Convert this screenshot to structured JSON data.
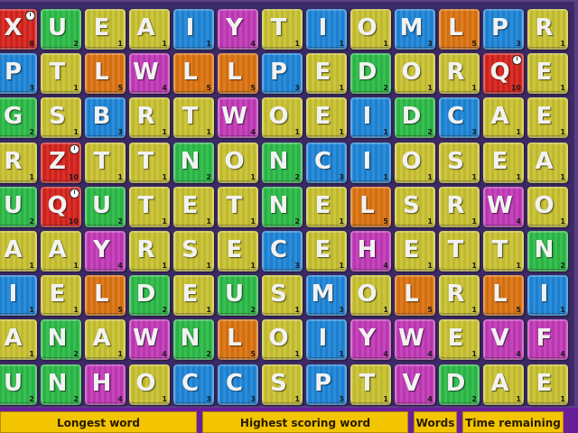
{
  "colors": {
    "Y": "#c9c233",
    "B": "#1f86d8",
    "G": "#2dbb48",
    "P": "#c23ab8",
    "O": "#dc7412",
    "R": "#d7241e"
  },
  "grid": [
    [
      [
        "X",
        "8",
        "R",
        true
      ],
      [
        "U",
        "2",
        "G"
      ],
      [
        "E",
        "1",
        "Y"
      ],
      [
        "A",
        "1",
        "Y"
      ],
      [
        "I",
        "1",
        "B"
      ],
      [
        "Y",
        "4",
        "P"
      ],
      [
        "T",
        "1",
        "Y"
      ],
      [
        "I",
        "1",
        "B"
      ],
      [
        "O",
        "1",
        "Y"
      ],
      [
        "M",
        "3",
        "B"
      ],
      [
        "L",
        "5",
        "O"
      ],
      [
        "P",
        "3",
        "B"
      ],
      [
        "R",
        "1",
        "Y"
      ]
    ],
    [
      [
        "P",
        "3",
        "B"
      ],
      [
        "T",
        "1",
        "Y"
      ],
      [
        "L",
        "5",
        "O"
      ],
      [
        "W",
        "4",
        "P"
      ],
      [
        "L",
        "5",
        "O"
      ],
      [
        "L",
        "5",
        "O"
      ],
      [
        "P",
        "3",
        "B"
      ],
      [
        "E",
        "1",
        "Y"
      ],
      [
        "D",
        "2",
        "G"
      ],
      [
        "O",
        "1",
        "Y"
      ],
      [
        "R",
        "1",
        "Y"
      ],
      [
        "Q",
        "10",
        "R",
        true
      ],
      [
        "E",
        "1",
        "Y"
      ]
    ],
    [
      [
        "G",
        "2",
        "G"
      ],
      [
        "S",
        "1",
        "Y"
      ],
      [
        "B",
        "3",
        "B"
      ],
      [
        "R",
        "1",
        "Y"
      ],
      [
        "T",
        "1",
        "Y"
      ],
      [
        "W",
        "4",
        "P"
      ],
      [
        "O",
        "1",
        "Y"
      ],
      [
        "E",
        "1",
        "Y"
      ],
      [
        "I",
        "1",
        "B"
      ],
      [
        "D",
        "2",
        "G"
      ],
      [
        "C",
        "3",
        "B"
      ],
      [
        "A",
        "1",
        "Y"
      ],
      [
        "E",
        "1",
        "Y"
      ]
    ],
    [
      [
        "R",
        "1",
        "Y"
      ],
      [
        "Z",
        "10",
        "R",
        true
      ],
      [
        "T",
        "1",
        "Y"
      ],
      [
        "T",
        "1",
        "Y"
      ],
      [
        "N",
        "2",
        "G"
      ],
      [
        "O",
        "1",
        "Y"
      ],
      [
        "N",
        "2",
        "G"
      ],
      [
        "C",
        "3",
        "B"
      ],
      [
        "I",
        "1",
        "B"
      ],
      [
        "O",
        "1",
        "Y"
      ],
      [
        "S",
        "1",
        "Y"
      ],
      [
        "E",
        "1",
        "Y"
      ],
      [
        "A",
        "1",
        "Y"
      ]
    ],
    [
      [
        "U",
        "2",
        "G"
      ],
      [
        "Q",
        "10",
        "R",
        true
      ],
      [
        "U",
        "2",
        "G"
      ],
      [
        "T",
        "1",
        "Y"
      ],
      [
        "E",
        "1",
        "Y"
      ],
      [
        "T",
        "1",
        "Y"
      ],
      [
        "N",
        "2",
        "G"
      ],
      [
        "E",
        "1",
        "Y"
      ],
      [
        "L",
        "5",
        "O"
      ],
      [
        "S",
        "1",
        "Y"
      ],
      [
        "R",
        "1",
        "Y"
      ],
      [
        "W",
        "4",
        "P"
      ],
      [
        "O",
        "1",
        "Y"
      ]
    ],
    [
      [
        "A",
        "1",
        "Y"
      ],
      [
        "A",
        "1",
        "Y"
      ],
      [
        "Y",
        "4",
        "P"
      ],
      [
        "R",
        "1",
        "Y"
      ],
      [
        "S",
        "1",
        "Y"
      ],
      [
        "E",
        "1",
        "Y"
      ],
      [
        "C",
        "3",
        "B"
      ],
      [
        "E",
        "1",
        "Y"
      ],
      [
        "H",
        "4",
        "P"
      ],
      [
        "E",
        "1",
        "Y"
      ],
      [
        "T",
        "1",
        "Y"
      ],
      [
        "T",
        "1",
        "Y"
      ],
      [
        "N",
        "2",
        "G"
      ]
    ],
    [
      [
        "I",
        "1",
        "B"
      ],
      [
        "E",
        "1",
        "Y"
      ],
      [
        "L",
        "5",
        "O"
      ],
      [
        "D",
        "2",
        "G"
      ],
      [
        "E",
        "1",
        "Y"
      ],
      [
        "U",
        "2",
        "G"
      ],
      [
        "S",
        "1",
        "Y"
      ],
      [
        "M",
        "3",
        "B"
      ],
      [
        "O",
        "1",
        "Y"
      ],
      [
        "L",
        "5",
        "O"
      ],
      [
        "R",
        "1",
        "Y"
      ],
      [
        "L",
        "5",
        "O"
      ],
      [
        "I",
        "1",
        "B"
      ]
    ],
    [
      [
        "A",
        "1",
        "Y"
      ],
      [
        "N",
        "2",
        "G"
      ],
      [
        "A",
        "1",
        "Y"
      ],
      [
        "W",
        "4",
        "P"
      ],
      [
        "N",
        "2",
        "G"
      ],
      [
        "L",
        "5",
        "O"
      ],
      [
        "O",
        "1",
        "Y"
      ],
      [
        "I",
        "1",
        "B"
      ],
      [
        "Y",
        "4",
        "P"
      ],
      [
        "W",
        "4",
        "P"
      ],
      [
        "E",
        "1",
        "Y"
      ],
      [
        "V",
        "4",
        "P"
      ],
      [
        "F",
        "4",
        "P"
      ]
    ],
    [
      [
        "U",
        "2",
        "G"
      ],
      [
        "N",
        "2",
        "G"
      ],
      [
        "H",
        "4",
        "P"
      ],
      [
        "O",
        "1",
        "Y"
      ],
      [
        "C",
        "3",
        "B"
      ],
      [
        "C",
        "3",
        "B"
      ],
      [
        "S",
        "1",
        "Y"
      ],
      [
        "P",
        "3",
        "B"
      ],
      [
        "T",
        "1",
        "Y"
      ],
      [
        "V",
        "4",
        "P"
      ],
      [
        "D",
        "2",
        "G"
      ],
      [
        "A",
        "1",
        "Y"
      ],
      [
        "E",
        "1",
        "Y"
      ]
    ]
  ],
  "panels": {
    "longest_word": "Longest word",
    "highest_scoring_word": "Highest scoring word",
    "words": "Words",
    "time_remaining": "Time remaining"
  }
}
